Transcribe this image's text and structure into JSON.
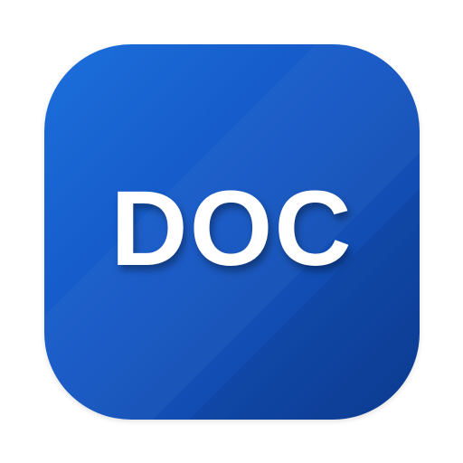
{
  "icon": {
    "label": "DOC",
    "colors": {
      "gradient_start": "#1c6fdc",
      "gradient_mid": "#1457c5",
      "gradient_end": "#0d3f99",
      "label": "#ffffff",
      "background": "#ffffff"
    }
  }
}
